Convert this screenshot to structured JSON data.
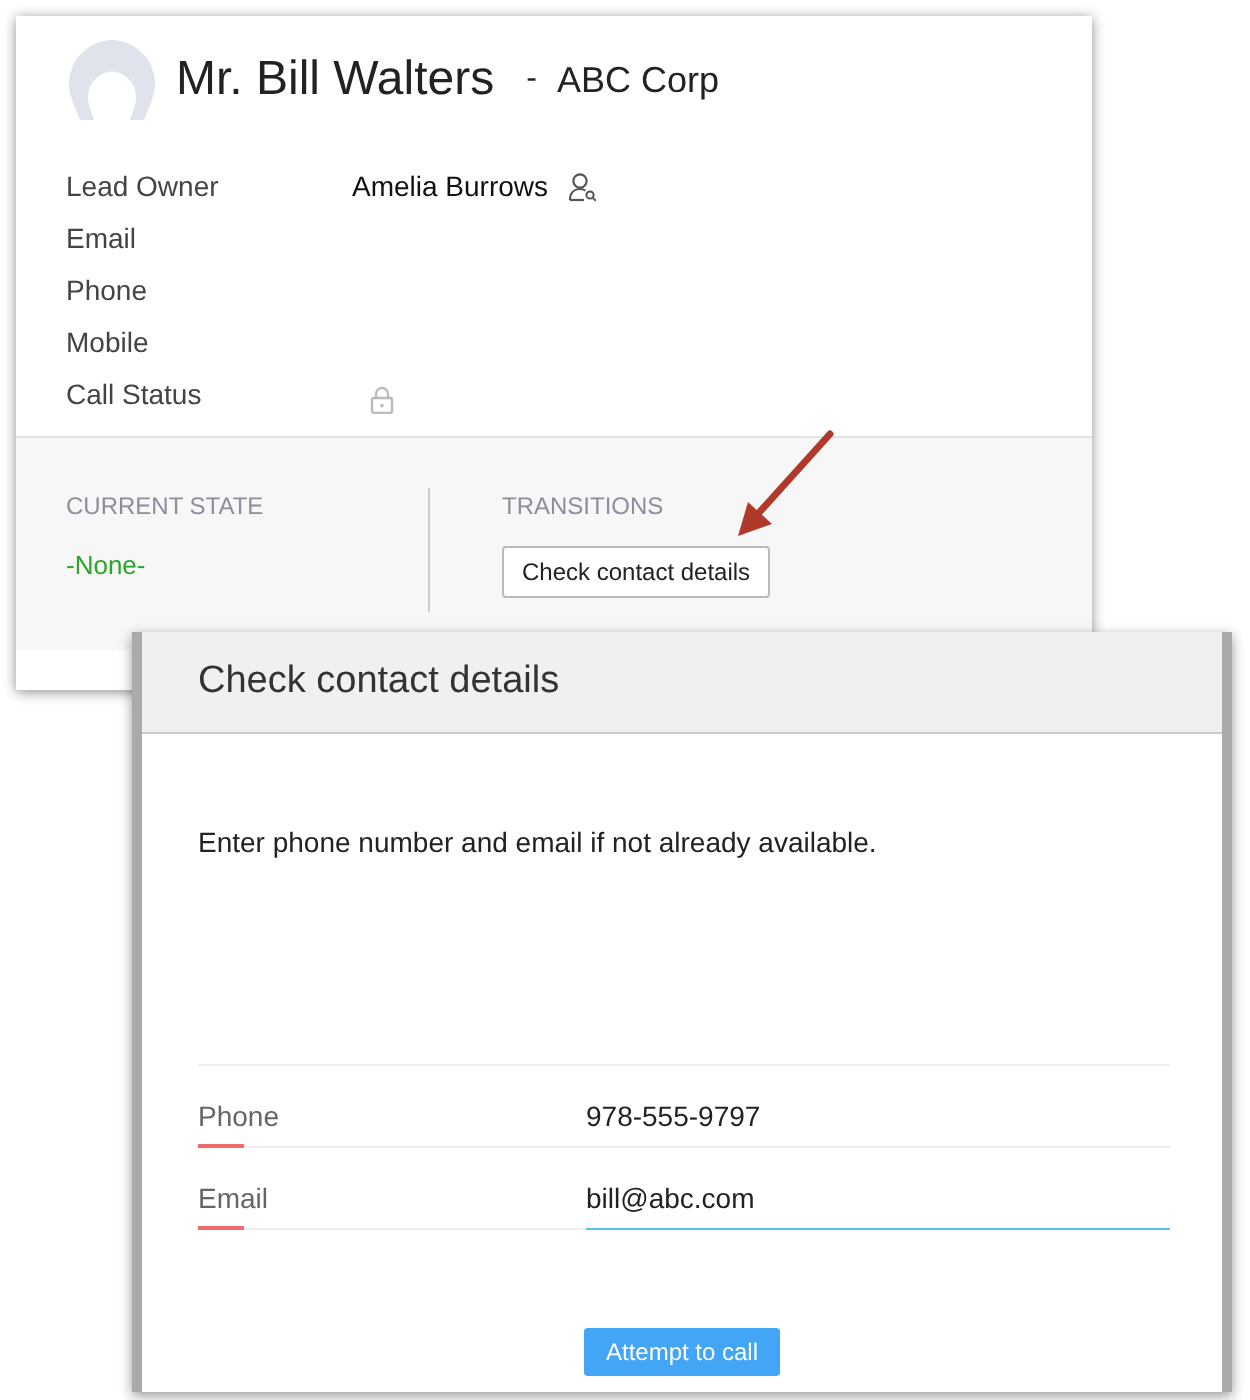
{
  "record": {
    "name": "Mr. Bill Walters",
    "separator": "-",
    "company": "ABC Corp",
    "fields": [
      {
        "label": "Lead Owner",
        "value": "Amelia Burrows",
        "kind": "owner"
      },
      {
        "label": "Email",
        "kind": "text"
      },
      {
        "label": "Phone",
        "kind": "text"
      },
      {
        "label": "Mobile",
        "kind": "text"
      },
      {
        "label": "Call Status",
        "kind": "locked"
      }
    ],
    "current_state": {
      "heading": "CURRENT STATE",
      "value": "-None-"
    },
    "transitions": {
      "heading": "TRANSITIONS",
      "buttons": [
        "Check contact details"
      ]
    }
  },
  "dialog": {
    "title": "Check contact details",
    "message": "Enter phone number and email if not already available.",
    "fields": [
      {
        "label": "Phone",
        "value": "978-555-9797",
        "required": true,
        "focused": false
      },
      {
        "label": "Email",
        "value": "bill@abc.com",
        "required": true,
        "focused": true
      }
    ],
    "button": "Attempt to call"
  }
}
